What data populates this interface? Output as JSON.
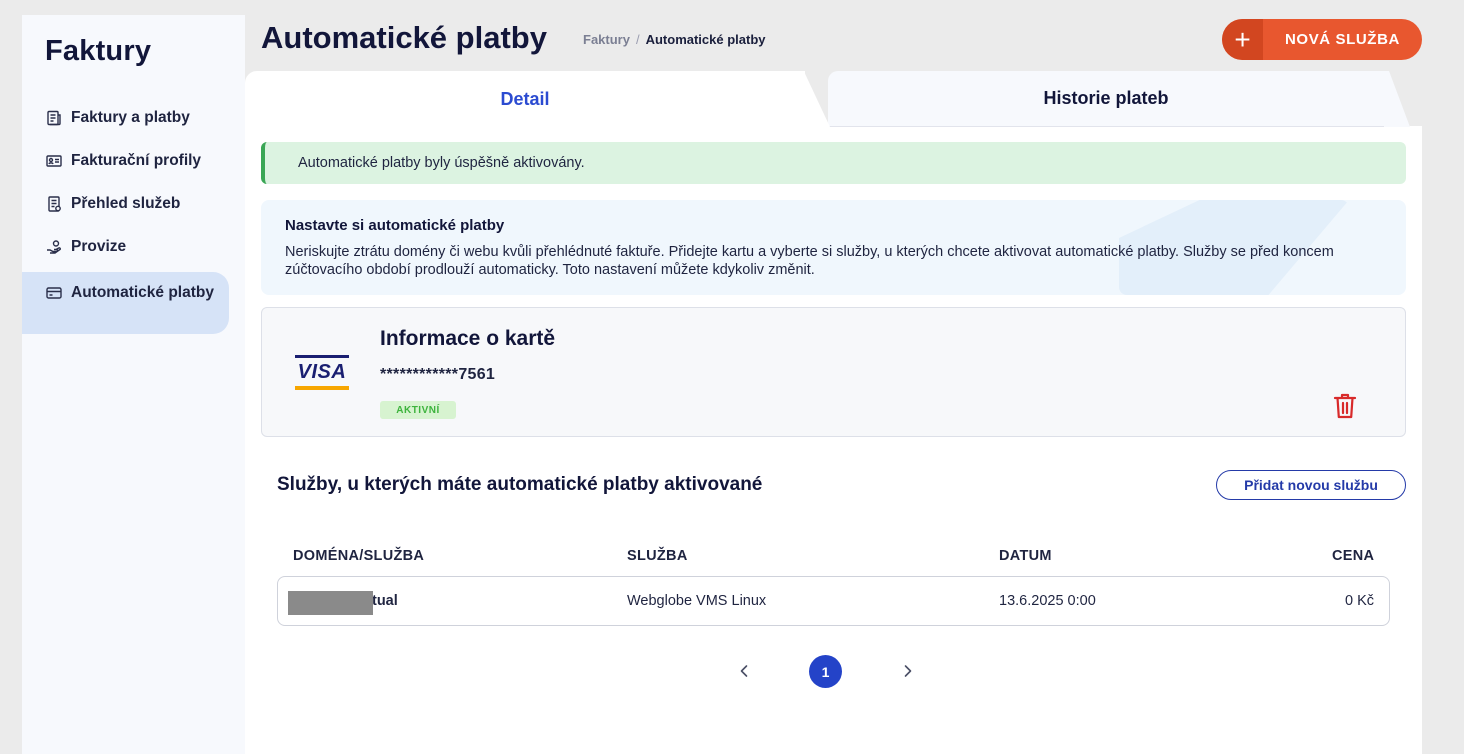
{
  "sidebar": {
    "title": "Faktury",
    "items": [
      {
        "label": "Faktury a platby",
        "icon": "invoice-icon"
      },
      {
        "label": "Fakturační profily",
        "icon": "profile-card-icon"
      },
      {
        "label": "Přehled služeb",
        "icon": "services-list-icon"
      },
      {
        "label": "Provize",
        "icon": "hand-coin-icon"
      },
      {
        "label": "Automatické platby",
        "icon": "wallet-card-icon"
      }
    ]
  },
  "header": {
    "title": "Automatické platby",
    "breadcrumb": {
      "parent": "Faktury",
      "separator": "/",
      "current": "Automatické platby"
    },
    "new_button": "NOVÁ SLUŽBA"
  },
  "tabs": {
    "detail": "Detail",
    "history": "Historie plateb"
  },
  "alert": "Automatické platby byly úspěšně aktivovány.",
  "info": {
    "title": "Nastavte si automatické platby",
    "text": "Neriskujte ztrátu domény či webu kvůli přehlédnuté faktuře. Přidejte kartu a vyberte si služby, u kterých chcete aktivovat automatické platby. Služby se před koncem zúčtovacího období prodlouží automaticky. Toto nastavení můžete kdykoliv změnit."
  },
  "card": {
    "brand": "VISA",
    "title": "Informace o kartě",
    "number": "************7561",
    "status": "AKTIVNÍ"
  },
  "services": {
    "title": "Služby, u kterých máte automatické platby aktivované",
    "add_button": "Přidat novou službu",
    "columns": [
      "DOMÉNA/SLUŽBA",
      "SLUŽBA",
      "DATUM",
      "CENA"
    ],
    "rows": [
      {
        "domain": "tual",
        "service": "Webglobe VMS Linux",
        "date": "13.6.2025 0:00",
        "price": "0 Kč"
      }
    ]
  },
  "pagination": {
    "current": "1"
  },
  "colors": {
    "accent": "#e8572f",
    "primary": "#2443c8",
    "success_bg": "#dcf3e1",
    "active_nav": "#d6e3f7"
  }
}
